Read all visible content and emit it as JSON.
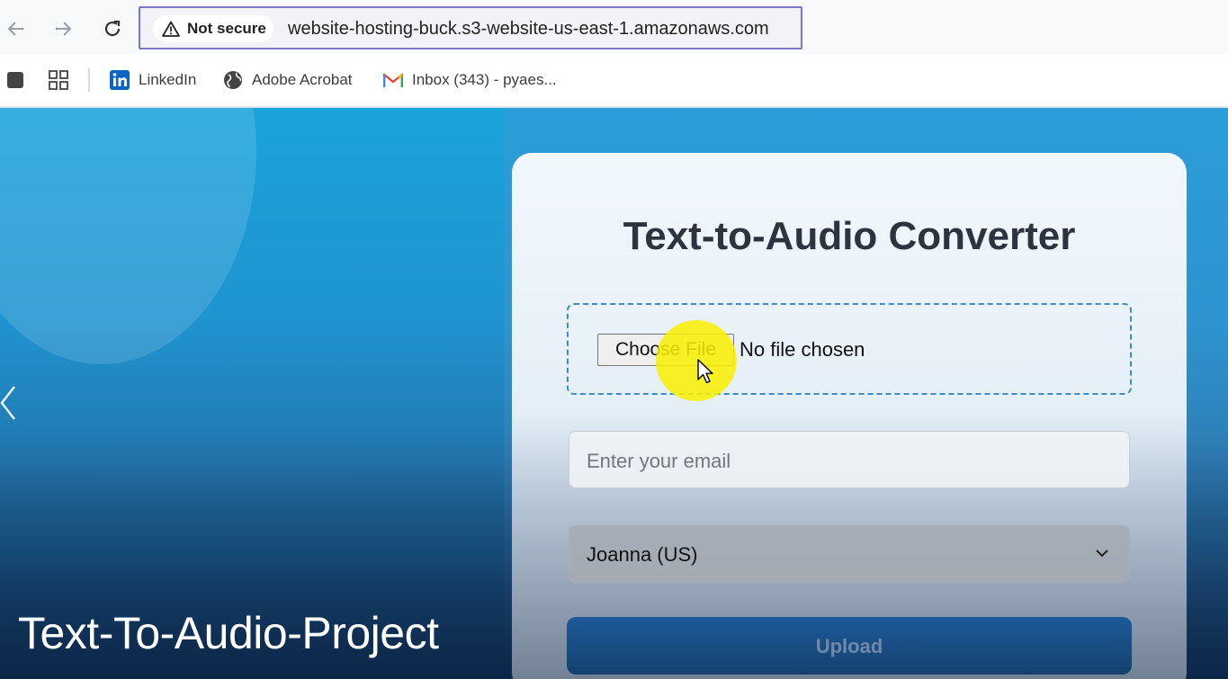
{
  "browser": {
    "security_label": "Not secure",
    "url": "website-hosting-buck.s3-website-us-east-1.amazonaws.com"
  },
  "bookmarks": [
    {
      "label": "LinkedIn",
      "icon": "linkedin-icon"
    },
    {
      "label": "Adobe Acrobat",
      "icon": "globe-icon"
    },
    {
      "label": "Inbox (343) - pyaes...",
      "icon": "gmail-icon"
    }
  ],
  "slide": {
    "title": "Text-To-Audio-Project"
  },
  "converter": {
    "title": "Text-to-Audio Converter",
    "file_button": "Choose File",
    "file_status": "No file chosen",
    "email_placeholder": "Enter your email",
    "voice_selected": "Joanna (US)",
    "upload_label": "Upload"
  },
  "colors": {
    "omnibox_border": "#7b78c2",
    "upload_button": "#1e5a98",
    "dropzone_border": "#3d8cc6",
    "cursor_highlight": "#faf000"
  }
}
